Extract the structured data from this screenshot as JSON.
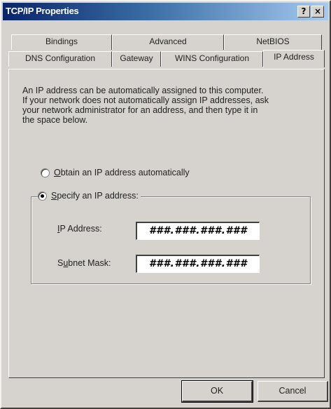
{
  "window": {
    "title": "TCP/IP Properties",
    "help_button": "?",
    "close_button": "×"
  },
  "tabs": {
    "row1": [
      "Bindings",
      "Advanced",
      "NetBIOS"
    ],
    "row2": [
      "DNS Configuration",
      "Gateway",
      "WINS Configuration",
      "IP Address"
    ],
    "active": "IP Address"
  },
  "ip_tab": {
    "description": "An IP address can be automatically assigned to this computer.\nIf your network does not automatically assign IP addresses, ask\nyour network administrator for an address, and then type it in\nthe space below.",
    "option_auto": {
      "hotkey": "O",
      "rest": "btain an IP address automatically",
      "selected": false
    },
    "option_specify": {
      "hotkey": "S",
      "rest": "pecify an IP address:",
      "selected": true
    },
    "ip_address": {
      "hotkey": "I",
      "rest": "P Address:",
      "value": "###.###.###.###"
    },
    "subnet_mask": {
      "pre": "S",
      "hotkey": "u",
      "rest": "bnet Mask:",
      "value": "###.###.###.###"
    }
  },
  "buttons": {
    "ok": "OK",
    "cancel": "Cancel"
  }
}
